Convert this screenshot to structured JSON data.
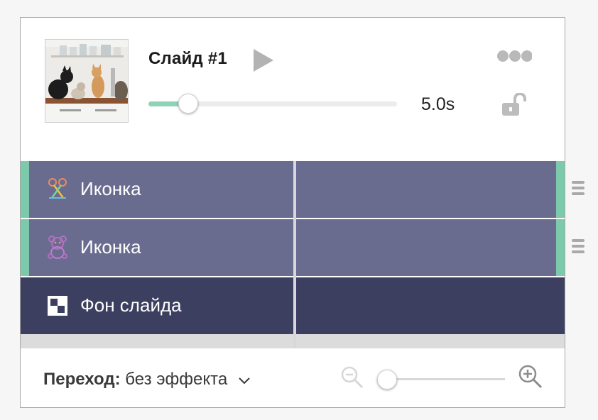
{
  "slide": {
    "title": "Слайд #1",
    "duration_label": "5.0s",
    "duration_progress": 0.16,
    "thumbnail": "cats-kitchen-photo"
  },
  "layers": [
    {
      "label": "Иконка",
      "icon": "scissors-icon",
      "kind": "icon-layer"
    },
    {
      "label": "Иконка",
      "icon": "teddy-bear-icon",
      "kind": "icon-layer"
    },
    {
      "label": "Фон слайда",
      "icon": "background-icon",
      "kind": "background"
    }
  ],
  "footer": {
    "transition_label": "Переход:",
    "transition_value": "без эффекта",
    "zoom_level": 0.0
  },
  "colors": {
    "accent": "#7cc9ab",
    "layer_bg": "#6a6c8f",
    "background_layer": "#3c3f5f"
  }
}
